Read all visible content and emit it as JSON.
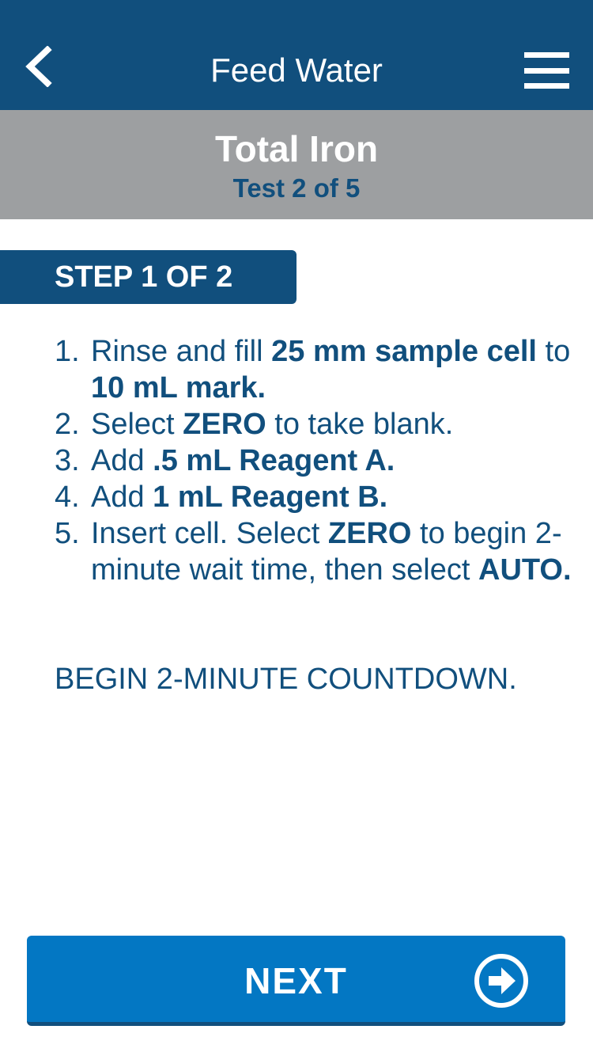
{
  "header": {
    "title": "Feed Water",
    "back_icon": "chevron-left-icon",
    "menu_icon": "hamburger-menu-icon"
  },
  "test": {
    "name": "Total Iron",
    "count": "Test 2 of 5"
  },
  "step": {
    "label": "STEP 1 OF 2"
  },
  "instructions": [
    {
      "num": "1.",
      "parts": [
        {
          "text": "Rinse and fill ",
          "bold": false
        },
        {
          "text": "25 mm sample cell",
          "bold": true
        },
        {
          "text": " to ",
          "bold": false
        },
        {
          "text": "10 mL mark.",
          "bold": true
        }
      ]
    },
    {
      "num": "2.",
      "parts": [
        {
          "text": "Select ",
          "bold": false
        },
        {
          "text": "ZERO",
          "bold": true
        },
        {
          "text": " to take blank.",
          "bold": false
        }
      ]
    },
    {
      "num": "3.",
      "parts": [
        {
          "text": "Add ",
          "bold": false
        },
        {
          "text": ".5 mL Reagent A.",
          "bold": true
        }
      ]
    },
    {
      "num": "4.",
      "parts": [
        {
          "text": "Add ",
          "bold": false
        },
        {
          "text": "1 mL Reagent B.",
          "bold": true
        }
      ]
    },
    {
      "num": "5.",
      "parts": [
        {
          "text": "Insert cell. Select ",
          "bold": false
        },
        {
          "text": "ZERO",
          "bold": true
        },
        {
          "text": " to begin 2-minute wait time, then select ",
          "bold": false
        },
        {
          "text": "AUTO.",
          "bold": true
        }
      ]
    }
  ],
  "countdown": "BEGIN 2-MINUTE COUNTDOWN.",
  "next_button": {
    "label": "NEXT",
    "icon": "arrow-right-circle-icon"
  },
  "colors": {
    "header_bg": "#114f7d",
    "subheader_bg": "#9d9fa1",
    "button_bg": "#0377c3",
    "text_primary": "#114f7d"
  }
}
